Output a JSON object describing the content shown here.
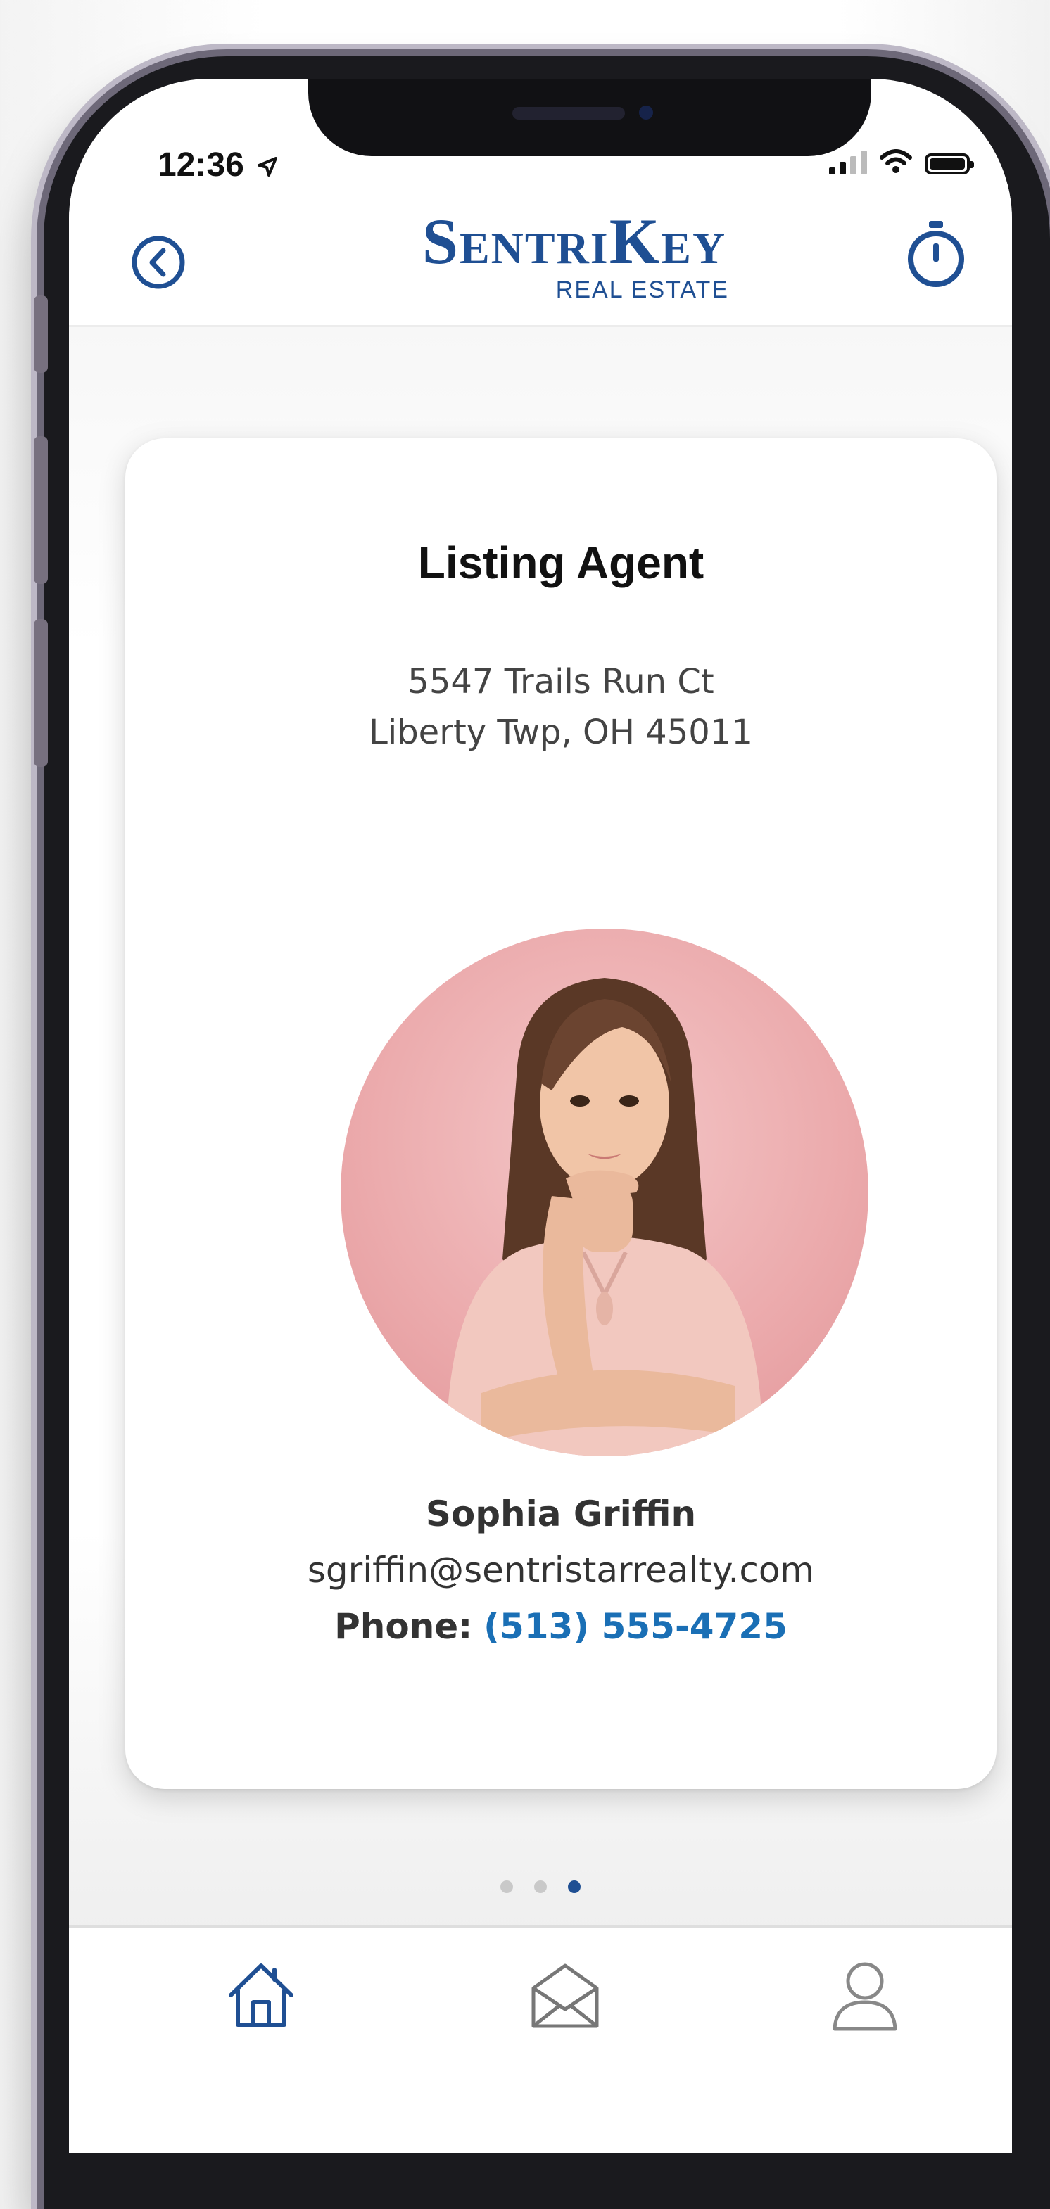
{
  "status_bar": {
    "time": "12:36"
  },
  "header": {
    "logo_main": "SentriKey",
    "logo_sub": "REAL ESTATE"
  },
  "card": {
    "title": "Listing Agent",
    "address_line1": "5547 Trails Run Ct",
    "address_line2": "Liberty Twp, OH 45011",
    "agent_name": "Sophia Griffin",
    "agent_email": "sgriffin@sentristarrealty.com",
    "phone_label": "Phone:",
    "phone_number": "(513) 555-4725"
  },
  "pager": {
    "count": 3,
    "active_index": 2
  },
  "tabs": [
    {
      "icon": "home-icon"
    },
    {
      "icon": "mail-icon"
    },
    {
      "icon": "profile-icon"
    }
  ],
  "colors": {
    "brand": "#1f4f93",
    "link": "#1a6fb5",
    "avatar_bg": "#eba9ab"
  }
}
